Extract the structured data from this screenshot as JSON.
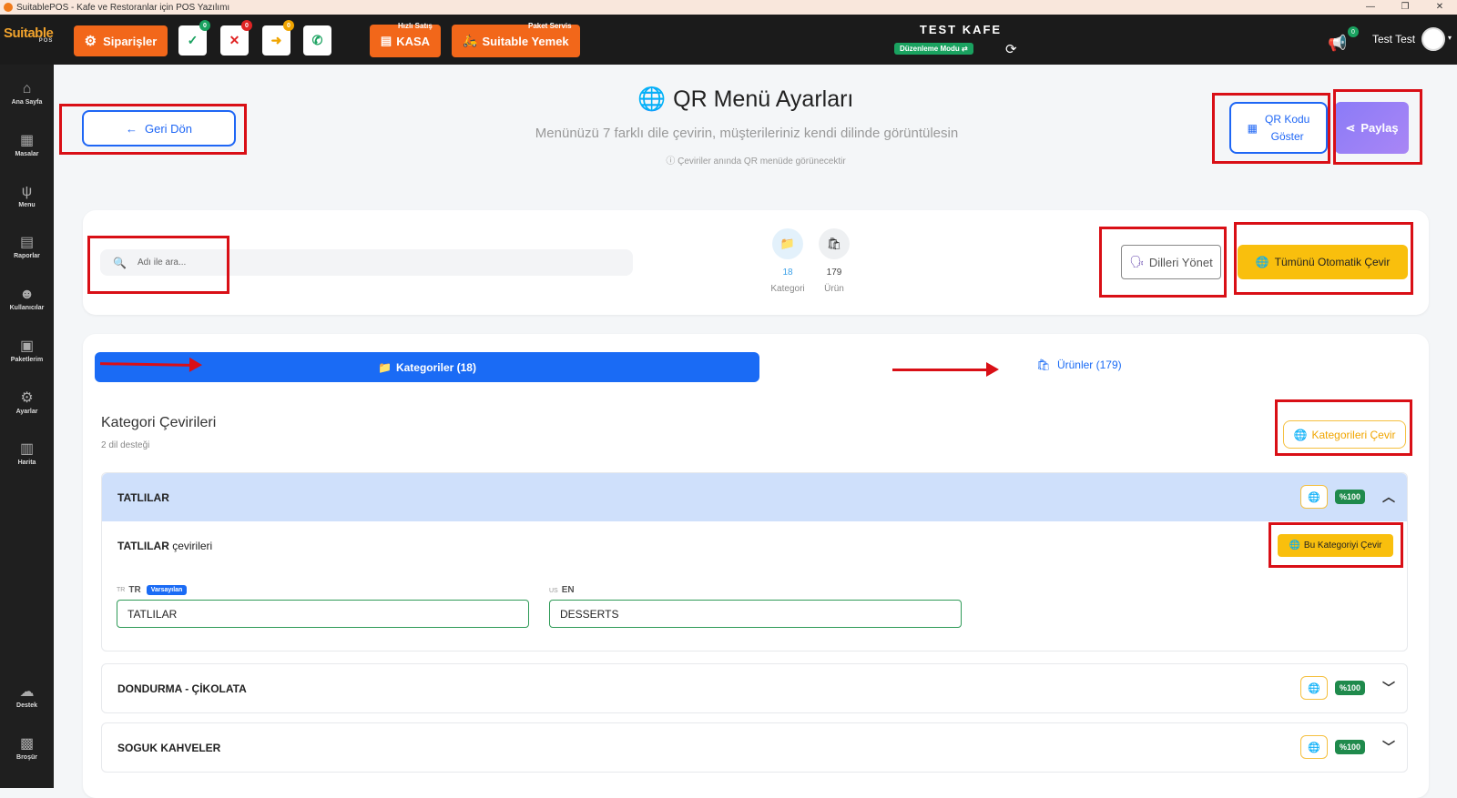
{
  "window": {
    "title": "SuitablePOS - Kafe ve Restoranlar için POS Yazılımı",
    "controls": [
      "—",
      "❐",
      "✕"
    ]
  },
  "topbar": {
    "logo": "Suitable",
    "logo_sub": "POS",
    "orders_label": "Siparişler",
    "status_buttons": [
      {
        "glyph": "✓",
        "count": "0",
        "color": "#1aa260",
        "dot": "#1aa260"
      },
      {
        "glyph": "✕",
        "count": "0",
        "color": "#e02424",
        "dot": "#e02424"
      },
      {
        "glyph": "➜",
        "count": "0",
        "color": "#f0a500",
        "dot": "#f0a500"
      },
      {
        "glyph": "✆",
        "count": "",
        "color": "#1aa260",
        "dot": ""
      }
    ],
    "quick_sale_caption": "Hızlı Satış",
    "cash_label": "KASA",
    "package_caption": "Paket Servis",
    "package_label": "Suitable Yemek",
    "brand": "TEST KAFE",
    "edit_mode": "Düzenleme Modu ⇄",
    "notif_count": "0",
    "user_name": "Test Test"
  },
  "sidebar": {
    "items": [
      {
        "label": "Ana Sayfa",
        "icon": "⌂"
      },
      {
        "label": "Masalar",
        "icon": "▦"
      },
      {
        "label": "Menu",
        "icon": "ψ"
      },
      {
        "label": "Raporlar",
        "icon": "▤"
      },
      {
        "label": "Kullanıcılar",
        "icon": "☻"
      },
      {
        "label": "Paketlerim",
        "icon": "▣"
      },
      {
        "label": "Ayarlar",
        "icon": "⚙"
      },
      {
        "label": "Harita",
        "icon": "▥"
      },
      {
        "label": "Destek",
        "icon": "☁"
      },
      {
        "label": "Broşür",
        "icon": "▩"
      }
    ]
  },
  "header": {
    "back_label": "Geri Dön",
    "title": "QR Menü Ayarları",
    "subtitle": "Menünüzü 7 farklı dile çevirin, müşterileriniz kendi dilinde görüntülesin",
    "note": "Çeviriler anında QR menüde görünecektir",
    "qr_label_1": "QR Kodu",
    "qr_label_2": "Göster",
    "share_label": "Paylaş"
  },
  "toolbar": {
    "search_placeholder": "Adı ile ara...",
    "stats": [
      {
        "value": "18",
        "label": "Kategori",
        "color": "#3aa0e8"
      },
      {
        "value": "179",
        "label": "Ürün",
        "color": "#444"
      }
    ],
    "manage_languages": "Dilleri Yönet",
    "auto_translate_all": "Tümünü Otomatik Çevir"
  },
  "tabs": {
    "categories": "Kategoriler (18)",
    "products": "Ürünler (179)"
  },
  "section": {
    "title": "Kategori Çevirileri",
    "subtitle": "2 dil desteği",
    "translate_categories": "Kategorileri Çevir"
  },
  "categories": [
    {
      "name": "TATLILAR",
      "percent": "%100",
      "expanded": true,
      "translations_suffix": "çevirileri",
      "translate_this": "Bu Kategoriyi Çevir",
      "fields": [
        {
          "flag": "TR",
          "code": "TR",
          "badge": "Varsayılan",
          "value": "TATLILAR"
        },
        {
          "flag": "US",
          "code": "EN",
          "badge": "",
          "value": "DESSERTS"
        }
      ]
    },
    {
      "name": "DONDURMA - ÇİKOLATA",
      "percent": "%100",
      "expanded": false
    },
    {
      "name": "SOGUK KAHVELER",
      "percent": "%100",
      "expanded": false
    }
  ]
}
